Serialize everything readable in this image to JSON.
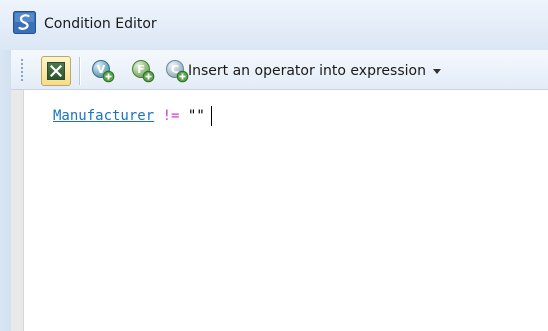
{
  "window": {
    "title": "Condition Editor",
    "icon": "condition-editor-app-icon"
  },
  "toolbar": {
    "buttons": [
      {
        "icon": "expression-toggle-icon",
        "active": true
      },
      {
        "icon": "insert-variable-icon"
      },
      {
        "icon": "insert-function-icon"
      },
      {
        "icon": "insert-constant-icon"
      }
    ],
    "insert_operator_label": "Insert an operator into expression"
  },
  "editor": {
    "expression": {
      "field": "Manufacturer",
      "operator": "!=",
      "value": "\"\""
    }
  },
  "colors": {
    "field_link": "#1a73c7",
    "operator": "#d23ad2",
    "title_bar": "#dbe7f5",
    "toolbar_active": "#f9dc87"
  }
}
